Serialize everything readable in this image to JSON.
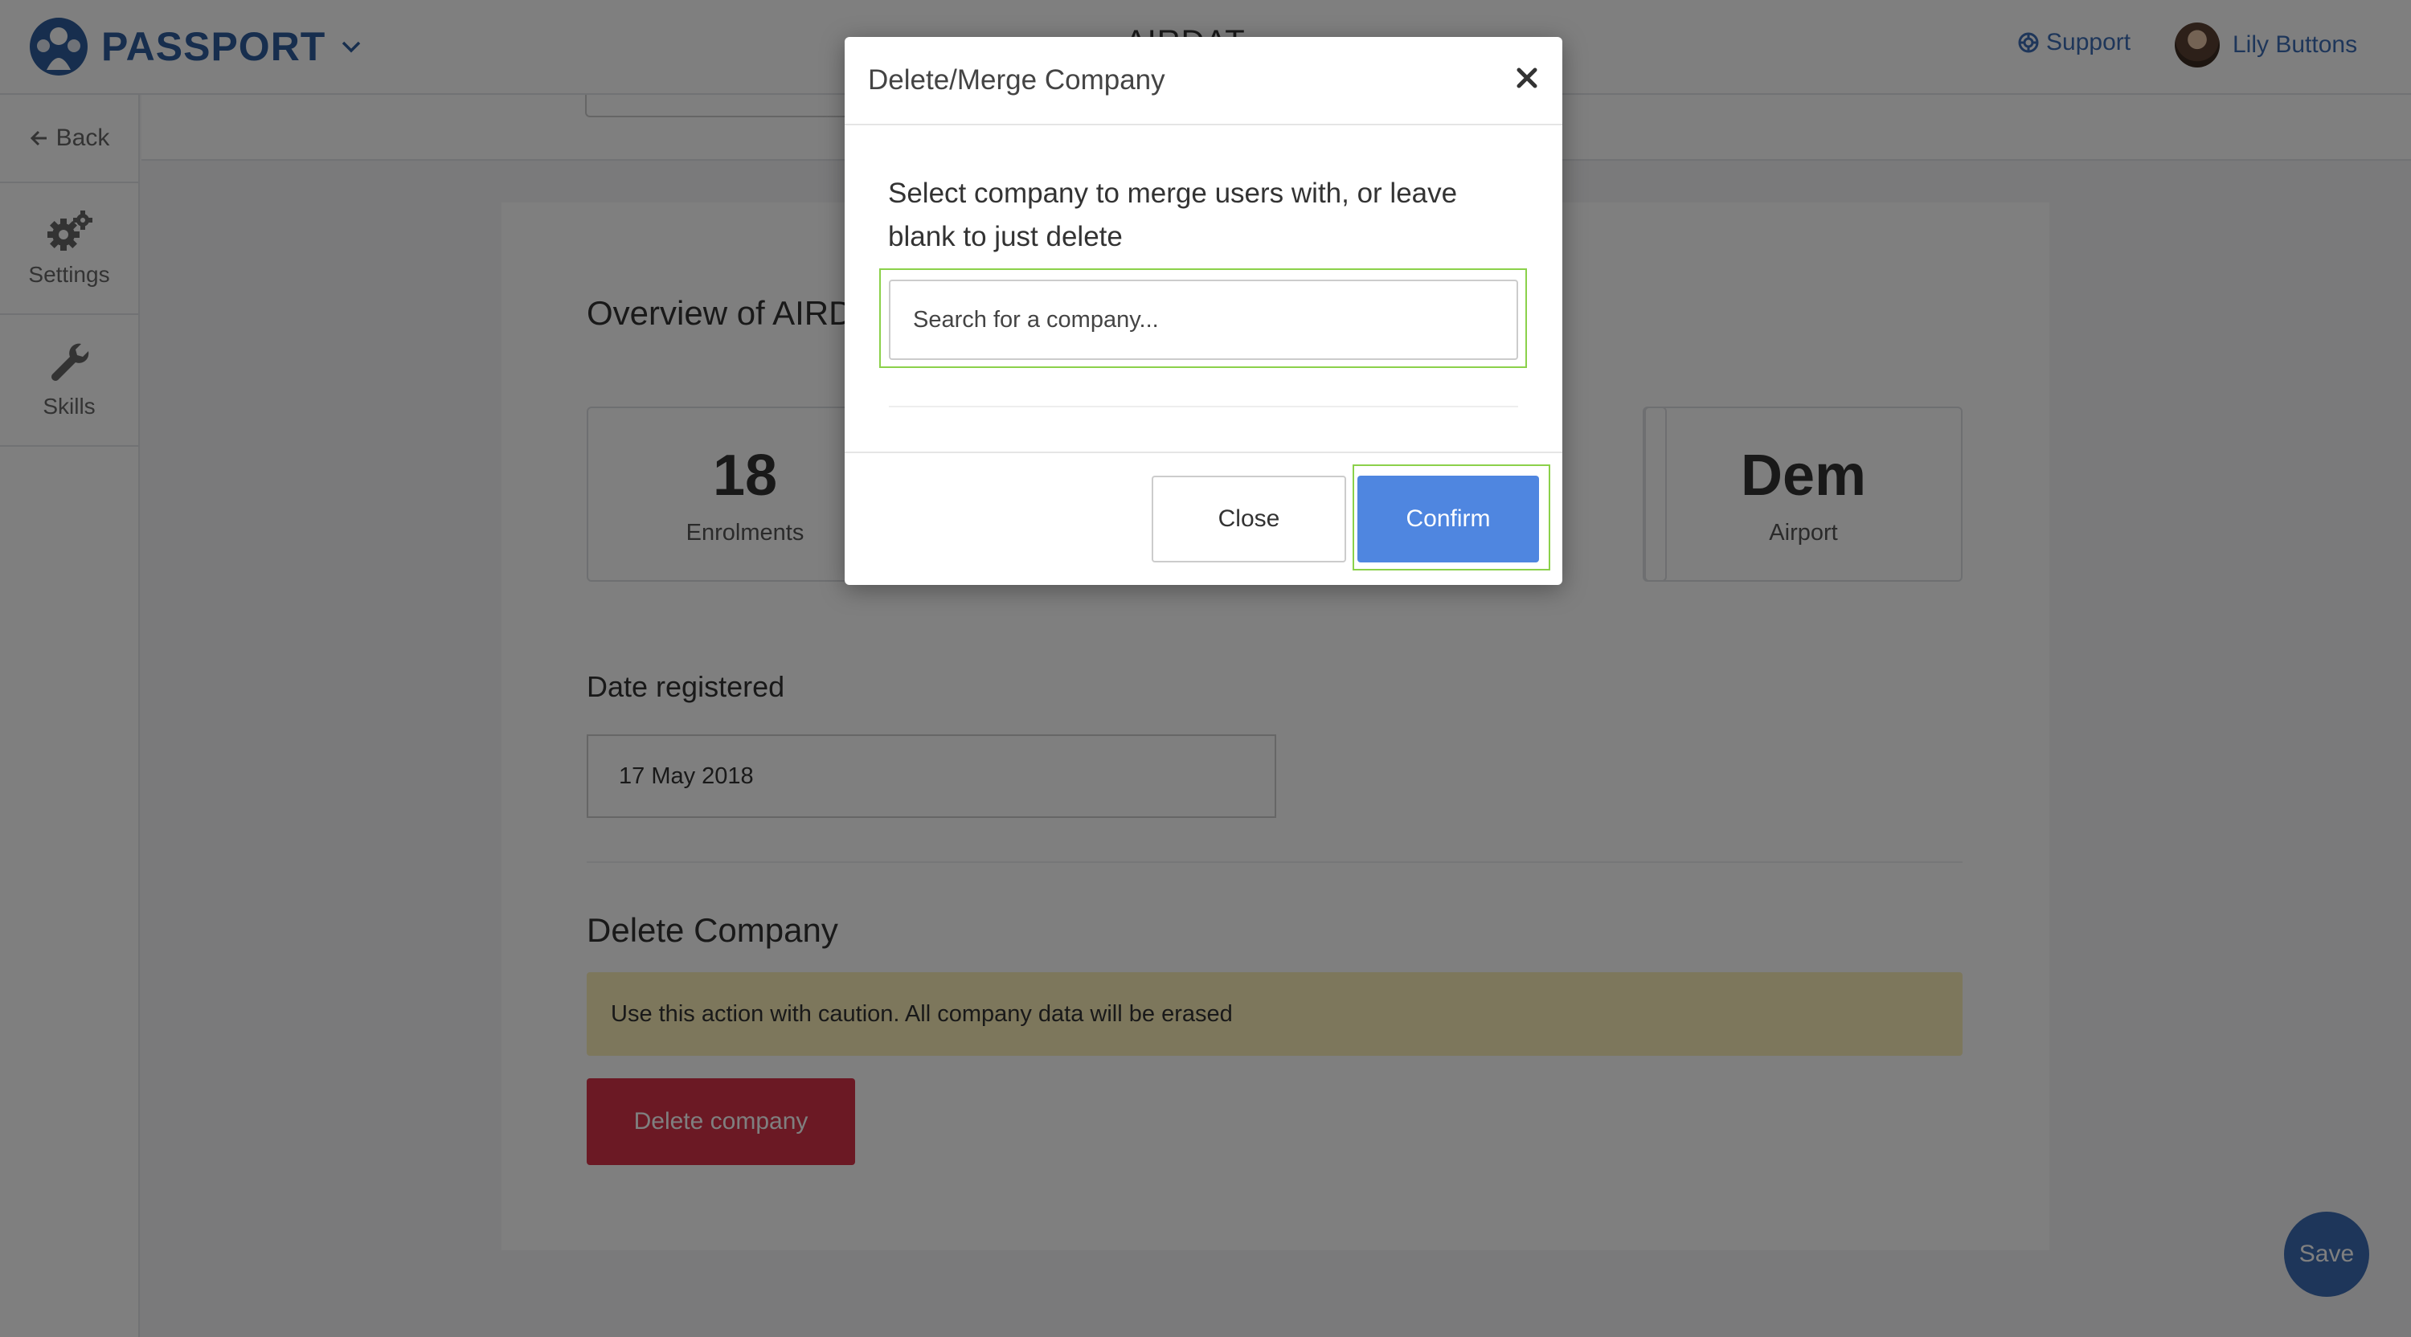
{
  "header": {
    "brand": "PASSPORT",
    "page_title": "AIRDAT",
    "support_label": "Support",
    "user_name": "Lily Buttons"
  },
  "sidebar": {
    "back_label": "Back",
    "items": [
      {
        "label": "Settings",
        "icon": "gears-icon"
      },
      {
        "label": "Skills",
        "icon": "wrench-icon"
      }
    ]
  },
  "overview": {
    "title": "Overview of AIRDAT",
    "stats": [
      {
        "value": "18",
        "label": "Enrolments"
      },
      {
        "value": "Dem",
        "label": "Airport"
      }
    ]
  },
  "date_registered": {
    "label": "Date registered",
    "value": "17 May 2018"
  },
  "delete_section": {
    "title": "Delete Company",
    "warning": "Use this action with caution. All company data will be erased",
    "button_label": "Delete company"
  },
  "save_label": "Save",
  "modal": {
    "title": "Delete/Merge Company",
    "prompt": "Select company to merge users with, or leave blank to just delete",
    "search_placeholder": "Search for a company...",
    "close_label": "Close",
    "confirm_label": "Confirm"
  },
  "colors": {
    "brand": "#2f5d9c",
    "link": "#3d6cb5",
    "confirm": "#4f86e0",
    "danger": "#d73348",
    "warning_bg": "#fbeeb8",
    "focus_outline": "#8bd14a"
  }
}
